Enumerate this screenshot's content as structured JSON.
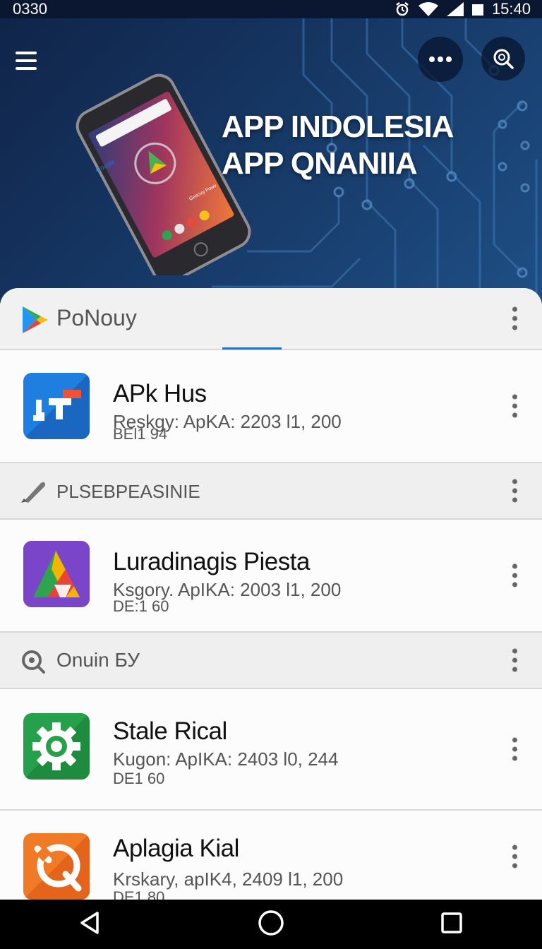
{
  "status_bar": {
    "time_left": "0330",
    "time_right": "15:40"
  },
  "hero": {
    "title_line1": "APP INDOLESIA",
    "title_line2": "APP QNANIIA",
    "phone_screen_search": "Google",
    "phone_screen_text": "Geeoxy Fowv"
  },
  "sections": [
    {
      "label": "PoNouy",
      "icon": "play-store-icon"
    },
    {
      "label": "PLSEBPEASINIE",
      "icon": "pen-icon"
    },
    {
      "label": "Onuin БУ",
      "icon": "search-icon"
    }
  ],
  "apps": [
    {
      "name": "APk Hus",
      "meta1": "Reskgy: ApKA: 2203 l1, 200",
      "meta2": "BEl1 94",
      "icon": "jt-app-icon",
      "icon_color": "#1f7fe0"
    },
    {
      "name": "Luradinagis Piesta",
      "meta1": "Ksgory. ApIKA: 2003 l1, 200",
      "meta2": "DE:1 60",
      "icon": "triangle-app-icon",
      "icon_color": "#7a45c9"
    },
    {
      "name": "Stale Rical",
      "meta1": "Kugon: ApIKA: 2403 l0, 244",
      "meta2": "DE1 60",
      "icon": "gear-app-icon",
      "icon_color": "#26a04a"
    },
    {
      "name": "Aplagia Kial",
      "meta1": "Krskary, apIK4, 2409 l1, 200",
      "meta2": "DE1 80",
      "icon": "tools-app-icon",
      "icon_color": "#f07a26"
    }
  ],
  "colors": {
    "hero_dark": "#102449",
    "accent": "#2a6fc0"
  }
}
